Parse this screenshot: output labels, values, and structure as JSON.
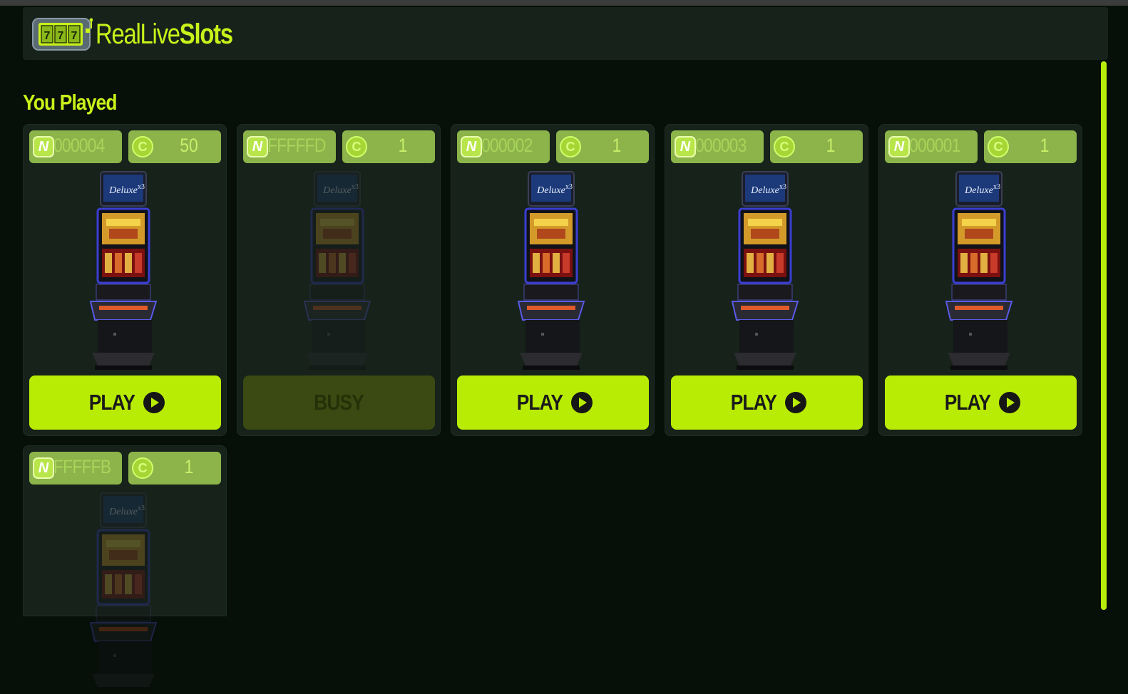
{
  "header": {
    "brand_light": "RealLive",
    "brand_bold": "Slots",
    "logo_icon": "slot-machine-777-icon"
  },
  "section": {
    "title": "You Played"
  },
  "colors": {
    "accent": "#b9ec04",
    "background": "#060f08",
    "card": "#16221a",
    "chip": "#8cb44a",
    "busy": "#3a4a12"
  },
  "machines": [
    {
      "id": "000004",
      "coins": "50",
      "button": "PLAY",
      "status": "available"
    },
    {
      "id": "FFFFFD",
      "coins": "1",
      "button": "BUSY",
      "status": "busy"
    },
    {
      "id": "000002",
      "coins": "1",
      "button": "PLAY",
      "status": "available"
    },
    {
      "id": "000003",
      "coins": "1",
      "button": "PLAY",
      "status": "available"
    },
    {
      "id": "000001",
      "coins": "1",
      "button": "PLAY",
      "status": "available"
    },
    {
      "id": "FFFFFB",
      "coins": "1",
      "button": "",
      "status": "offline"
    }
  ],
  "icons": {
    "network": "novomatic-n-icon",
    "coin": "coin-icon",
    "play": "play-circle-icon"
  }
}
